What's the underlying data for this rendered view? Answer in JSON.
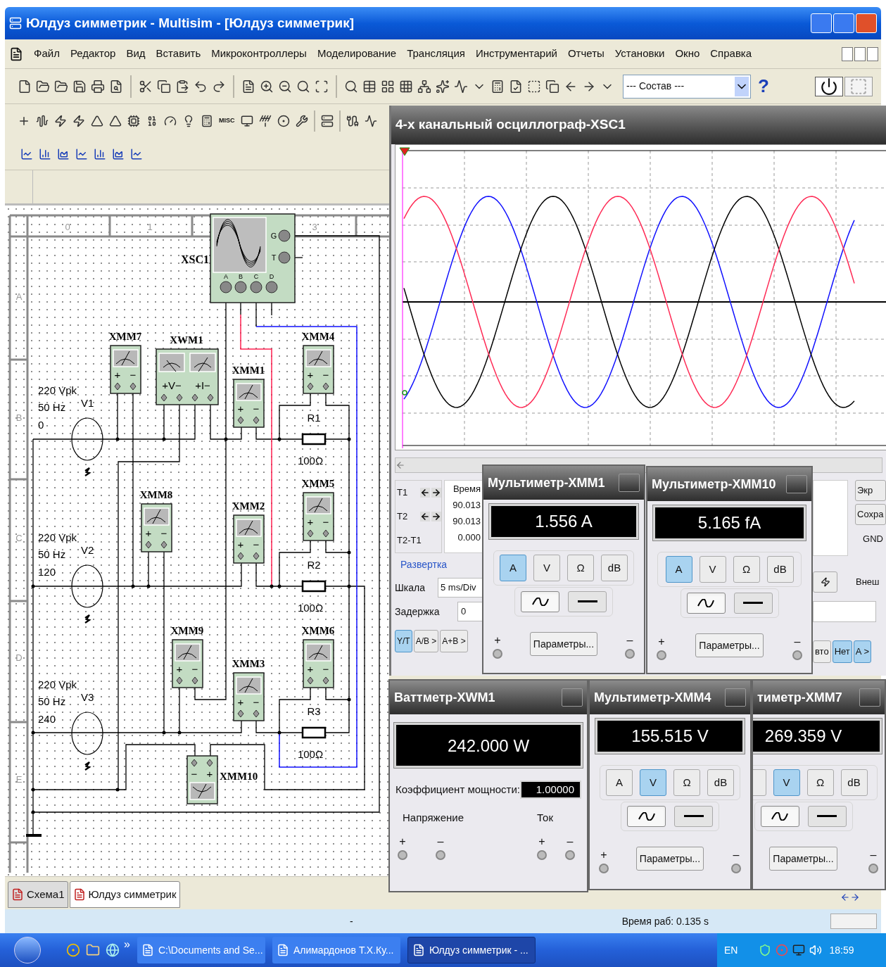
{
  "window": {
    "title": "Юлдуз симметрик - Multisim - [Юлдуз симметрик]"
  },
  "menu": [
    "Файл",
    "Редактор",
    "Вид",
    "Вставить",
    "Микроконтроллеры",
    "Моделирование",
    "Трансляция",
    "Инструментарий",
    "Отчеты",
    "Установки",
    "Окно",
    "Справка"
  ],
  "toolbar": {
    "component_combo": "--- Состав ---",
    "help": "?",
    "misc_label": "MISC"
  },
  "schematic": {
    "column_labels": [
      "0",
      "1",
      "3"
    ],
    "row_labels": [
      "A",
      "B",
      "C",
      "D",
      "E"
    ],
    "oscilloscope": {
      "label": "XSC1",
      "side_terminals": [
        "G",
        "T"
      ],
      "channel_terminals": [
        "A",
        "B",
        "C",
        "D"
      ]
    },
    "sources": [
      {
        "label": "V1",
        "amplitude": "220 Vpk",
        "frequency": "50 Hz",
        "phase": "0"
      },
      {
        "label": "V2",
        "amplitude": "220 Vpk",
        "frequency": "50 Hz",
        "phase": "120"
      },
      {
        "label": "V3",
        "amplitude": "220 Vpk",
        "frequency": "50 Hz",
        "phase": "240"
      }
    ],
    "meters": [
      {
        "label": "XMM7",
        "kind": "upright",
        "plus": "+",
        "minus": "−"
      },
      {
        "label": "XMM1",
        "kind": "upright",
        "plus": "+",
        "minus": "−"
      },
      {
        "label": "XMM4",
        "kind": "upright",
        "plus": "+",
        "minus": "−"
      },
      {
        "label": "XMM8",
        "kind": "upright",
        "plus": "+",
        "minus": "−"
      },
      {
        "label": "XMM2",
        "kind": "upright",
        "plus": "+",
        "minus": "−"
      },
      {
        "label": "XMM5",
        "kind": "upright",
        "plus": "+",
        "minus": "−"
      },
      {
        "label": "XMM9",
        "kind": "upright",
        "plus": "+",
        "minus": "−"
      },
      {
        "label": "XMM3",
        "kind": "upright",
        "plus": "+",
        "minus": "−"
      },
      {
        "label": "XMM6",
        "kind": "upright",
        "plus": "+",
        "minus": "−"
      },
      {
        "label": "XMM10",
        "kind": "inverted",
        "plus": "+",
        "minus": "−"
      }
    ],
    "wattmeter": {
      "label": "XWM1",
      "voltage_terminals": "+V−",
      "current_terminals": "+I−"
    },
    "resistors": [
      {
        "label": "R1",
        "value": "100Ω"
      },
      {
        "label": "R2",
        "value": "100Ω"
      },
      {
        "label": "R3",
        "value": "100Ω"
      }
    ]
  },
  "tabs": [
    {
      "label": "Схема1",
      "selected": false
    },
    {
      "label": "Юлдуз симметрик",
      "selected": true
    }
  ],
  "status_bar": {
    "left": "-",
    "run_time": "Время раб: 0.135 s"
  },
  "oscilloscope_window": {
    "title": "4-х канальный осциллограф-XSC1",
    "cursor_labels": [
      "T1",
      "T2",
      "T2-T1"
    ],
    "time_header": "Время",
    "time_values": [
      "90.013",
      "90.013",
      "0.000"
    ],
    "timebase": {
      "legend": "Развертка",
      "scale_label": "Шкала",
      "scale": "5 ms/Div",
      "delay_label": "Задержка",
      "delay": "0"
    },
    "display_modes": [
      {
        "label": "Y/T",
        "selected": true
      },
      {
        "label": "A/B >",
        "selected": false
      },
      {
        "label": "A+B >",
        "selected": false
      }
    ],
    "right_buttons": [
      "Экр",
      "Сохра"
    ],
    "ground_label": "GND",
    "trigger_source_label": "Внеш",
    "trigger_modes": [
      {
        "label": "вто",
        "selected": false
      },
      {
        "label": "Нет",
        "selected": true
      },
      {
        "label": "A >",
        "selected": true
      }
    ]
  },
  "multimeters": [
    {
      "title": "Мультиметр-XMM1",
      "reading": "1.556 A",
      "clipped": false,
      "modes": [
        {
          "label": "A",
          "selected": true
        },
        {
          "label": "V",
          "selected": false
        },
        {
          "label": "Ω",
          "selected": false
        },
        {
          "label": "dB",
          "selected": false
        }
      ],
      "signal": [
        {
          "kind": "ac",
          "selected": true
        },
        {
          "kind": "dc",
          "selected": false
        }
      ],
      "plus": "+",
      "minus": "–",
      "settings": "Параметры..."
    },
    {
      "title": "Мультиметр-XMM10",
      "reading": "5.165 fA",
      "clipped": false,
      "modes": [
        {
          "label": "A",
          "selected": true
        },
        {
          "label": "V",
          "selected": false
        },
        {
          "label": "Ω",
          "selected": false
        },
        {
          "label": "dB",
          "selected": false
        }
      ],
      "signal": [
        {
          "kind": "ac",
          "selected": true
        },
        {
          "kind": "dc",
          "selected": false
        }
      ],
      "plus": "+",
      "minus": "–",
      "settings": "Параметры..."
    },
    {
      "title": "Мультиметр-XMM4",
      "reading": "155.515 V",
      "clipped": false,
      "modes": [
        {
          "label": "A",
          "selected": false
        },
        {
          "label": "V",
          "selected": true
        },
        {
          "label": "Ω",
          "selected": false
        },
        {
          "label": "dB",
          "selected": false
        }
      ],
      "signal": [
        {
          "kind": "ac",
          "selected": true
        },
        {
          "kind": "dc",
          "selected": false
        }
      ],
      "plus": "+",
      "minus": "–",
      "settings": "Параметры..."
    },
    {
      "title": "тиметр-XMM7",
      "reading": "269.359 V",
      "clipped": true,
      "modes": [
        {
          "label": "V",
          "selected": true
        },
        {
          "label": "Ω",
          "selected": false
        },
        {
          "label": "dB",
          "selected": false
        }
      ],
      "signal": [
        {
          "kind": "ac",
          "selected": true
        },
        {
          "kind": "dc",
          "selected": false
        }
      ],
      "minus": "–",
      "settings": "Параметры..."
    }
  ],
  "wattmeter_window": {
    "title": "Ваттметр-XWM1",
    "reading": "242.000 W",
    "power_factor_label": "Коэффициент мощности:",
    "power_factor": "1.00000",
    "voltage_label": "Напряжение",
    "current_label": "Ток",
    "terminals": [
      "+",
      "–",
      "+",
      "–"
    ]
  },
  "taskbar": {
    "overflow": "»",
    "tasks": [
      {
        "label": "C:\\Documents and Se...",
        "selected": false
      },
      {
        "label": "Алимардонов Т.Х.Ку...",
        "selected": false
      },
      {
        "label": "Юлдуз симметрик - ...",
        "selected": true
      }
    ],
    "language": "EN",
    "clock": "18:59"
  }
}
